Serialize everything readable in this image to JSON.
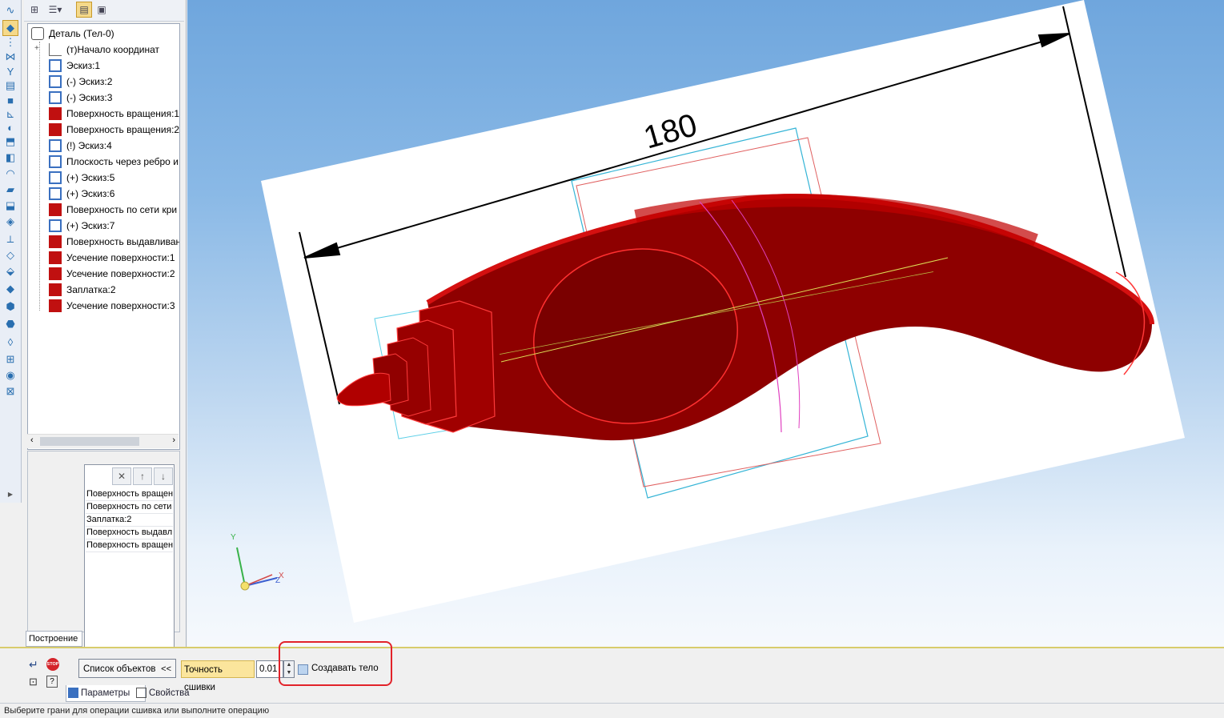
{
  "left_toolbar": {
    "icons": [
      "sketch-icon",
      "point-icon",
      "mirror-icon",
      "line-icon",
      "filter-icon",
      "spec-icon",
      "view-icon",
      "measure-icon",
      "surface-icon",
      "extrude-icon",
      "rotate-icon",
      "loft-icon",
      "sweep-icon",
      "patch-icon",
      "plane-icon",
      "axis-icon",
      "grid-icon",
      "sew-icon",
      "offset-icon",
      "fillet-icon",
      "trim-icon",
      "extend-icon",
      "cut-icon",
      "stitch-icon",
      "delete-face-icon"
    ],
    "expand_label": "▶"
  },
  "tree": {
    "root_label": "Деталь (Тел-0)",
    "items": [
      {
        "label": "(т)Начало координат",
        "icon": "origin-icon"
      },
      {
        "label": "Эскиз:1",
        "icon": "sketch-icon"
      },
      {
        "label": "(-) Эскиз:2",
        "icon": "sketch-icon"
      },
      {
        "label": "(-) Эскиз:3",
        "icon": "sketch-icon"
      },
      {
        "label": "Поверхность вращения:1",
        "icon": "revolve-surface-icon"
      },
      {
        "label": "Поверхность вращения:2",
        "icon": "revolve-surface-icon"
      },
      {
        "label": "(!) Эскиз:4",
        "icon": "sketch-icon"
      },
      {
        "label": "Плоскость через ребро и",
        "icon": "plane-icon"
      },
      {
        "label": "(+) Эскиз:5",
        "icon": "sketch-icon"
      },
      {
        "label": "(+) Эскиз:6",
        "icon": "sketch-icon"
      },
      {
        "label": "Поверхность по сети кри",
        "icon": "mesh-surface-icon"
      },
      {
        "label": "(+) Эскиз:7",
        "icon": "sketch-icon"
      },
      {
        "label": "Поверхность выдавливан",
        "icon": "extrude-surface-icon"
      },
      {
        "label": "Усечение поверхности:1",
        "icon": "trim-surface-icon"
      },
      {
        "label": "Усечение поверхности:2",
        "icon": "trim-surface-icon"
      },
      {
        "label": "Заплатка:2",
        "icon": "patch-icon"
      },
      {
        "label": "Усечение поверхности:3",
        "icon": "trim-surface-icon"
      }
    ]
  },
  "object_list": {
    "items": [
      "Поверхность вращен",
      "Поверхность по сети",
      "Заплатка:2",
      "Поверхность выдавл",
      "Поверхность вращен"
    ]
  },
  "construct_tab": "Построение",
  "viewport": {
    "dimension_value": "180",
    "axis_labels": {
      "y": "Y",
      "z": "Z",
      "x": "X"
    }
  },
  "property_bar": {
    "object_list_button": "Список объектов",
    "object_list_arrow": "<<",
    "precision_label": "Точность сшивки",
    "precision_value": "0.01",
    "create_body_label": "Создавать тело",
    "tab_params": "Параметры",
    "tab_properties": "Свойства"
  },
  "status_bar": {
    "text": "Выберите грани для операции сшивка или выполните операцию"
  },
  "colors": {
    "model_red": "#a80000",
    "highlight_red": "#e2232a",
    "precision_highlight": "#fbe59c",
    "sheet_white": "#ffffff"
  }
}
